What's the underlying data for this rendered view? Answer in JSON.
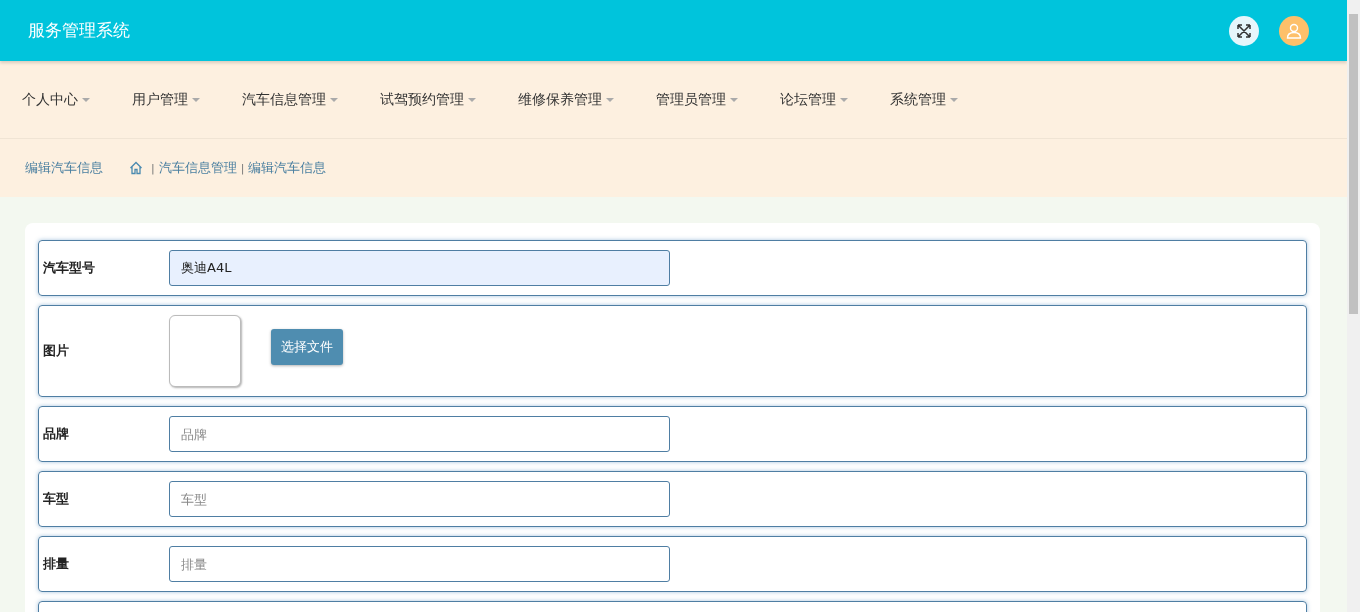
{
  "header": {
    "title": "服务管理系统"
  },
  "nav": [
    {
      "label": "个人中心"
    },
    {
      "label": "用户管理"
    },
    {
      "label": "汽车信息管理"
    },
    {
      "label": "试驾预约管理"
    },
    {
      "label": "维修保养管理"
    },
    {
      "label": "管理员管理"
    },
    {
      "label": "论坛管理"
    },
    {
      "label": "系统管理"
    }
  ],
  "breadcrumb": {
    "title": "编辑汽车信息",
    "separator": "|",
    "items": [
      "汽车信息管理",
      "编辑汽车信息"
    ]
  },
  "form": {
    "fields": [
      {
        "kind": "text",
        "label": "汽车型号",
        "value": "奥迪A4L",
        "filled": true
      },
      {
        "kind": "image",
        "label": "图片",
        "button": "选择文件"
      },
      {
        "kind": "text",
        "label": "品牌",
        "placeholder": "品牌",
        "filled": false
      },
      {
        "kind": "text",
        "label": "车型",
        "placeholder": "车型",
        "filled": false
      },
      {
        "kind": "text",
        "label": "排量",
        "placeholder": "排量",
        "filled": false
      }
    ]
  }
}
